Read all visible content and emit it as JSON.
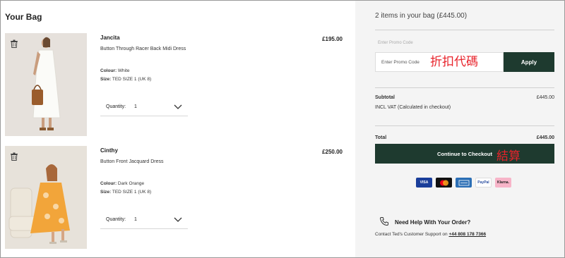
{
  "bag": {
    "title": "Your Bag",
    "items": [
      {
        "name": "Jancita",
        "description": "Button Through Racer Back Midi Dress",
        "colour_label": "Colour:",
        "colour": "White",
        "size_label": "Size:",
        "size": "TED SIZE 1 (UK 8)",
        "price": "£195.00",
        "quantity_label": "Quantity:",
        "quantity": "1"
      },
      {
        "name": "Cinthy",
        "description": "Button Front Jacquard Dress",
        "colour_label": "Colour:",
        "colour": "Dark Orange",
        "size_label": "Size:",
        "size": "TED SIZE 1 (UK 8)",
        "price": "£250.00",
        "quantity_label": "Quantity:",
        "quantity": "1"
      }
    ]
  },
  "summary": {
    "heading": "2 items in your bag (£445.00)",
    "promo_label": "Enter Promo Code",
    "promo_placeholder": "Enter Promo Code",
    "promo_annotation": "折扣代碼",
    "apply_label": "Apply",
    "subtotal_label": "Subtotal",
    "subtotal_value": "£445.00",
    "vat_note": "INCL VAT (Calculated in checkout)",
    "total_label": "Total",
    "total_value": "£445.00",
    "checkout_label": "Continue to Checkout",
    "checkout_annotation": "結算",
    "payments": [
      "VISA",
      "",
      "",
      "PayPal",
      "Klarna."
    ],
    "help_title": "Need Help With Your Order?",
    "help_text": "Contact Ted's Customer Support on",
    "help_phone": "+44 808 178 7366"
  },
  "colors": {
    "accent": "#1e3a2f",
    "annotation": "#e8222a",
    "summary_bg": "#f4f4f4"
  }
}
